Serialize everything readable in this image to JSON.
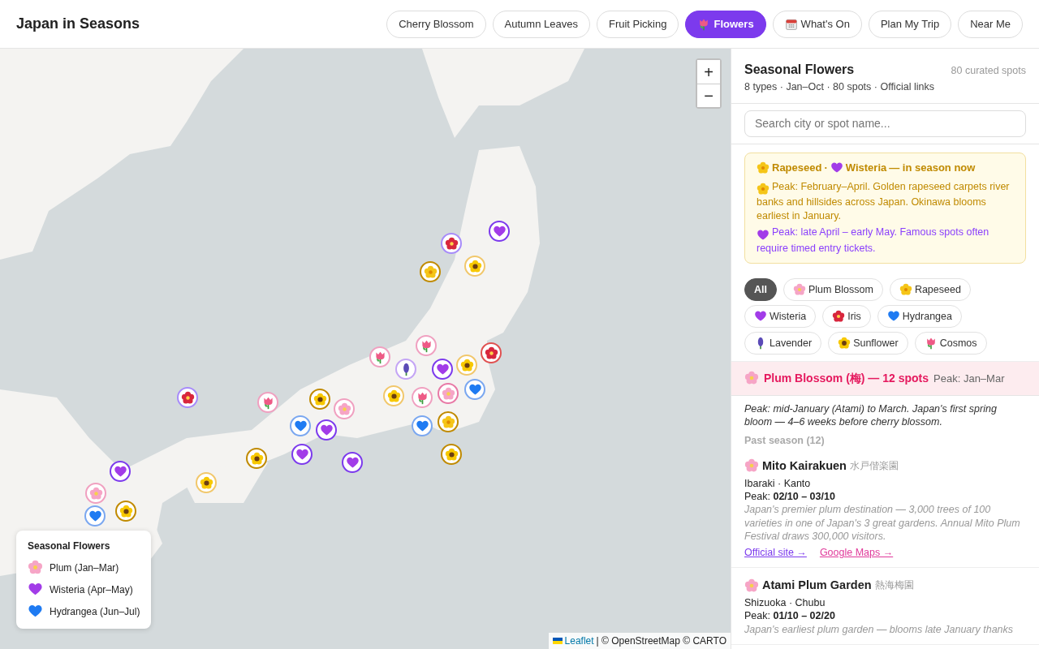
{
  "header": {
    "title": "Japan in Seasons",
    "nav": [
      {
        "label": "Cherry Blossom",
        "kind": "text",
        "selected": false
      },
      {
        "label": "Autumn Leaves",
        "kind": "text",
        "selected": false
      },
      {
        "label": "Fruit Picking",
        "kind": "text",
        "selected": false
      },
      {
        "label": "Flowers",
        "kind": "tulip",
        "selected": true
      },
      {
        "label": "What's On",
        "kind": "calendar",
        "selected": false
      },
      {
        "label": "Plan My Trip",
        "kind": "text",
        "selected": false
      },
      {
        "label": "Near Me",
        "kind": "text",
        "selected": false
      }
    ]
  },
  "map": {
    "zoom_in": "+",
    "zoom_out": "−",
    "legend": {
      "title": "Seasonal Flowers",
      "items": [
        {
          "kind": "plum",
          "label": "Plum (Jan–Mar)"
        },
        {
          "kind": "wisteria",
          "label": "Wisteria (Apr–May)"
        },
        {
          "kind": "hydrangea",
          "label": "Hydrangea (Jun–Jul)"
        }
      ]
    },
    "attribution": {
      "link": "Leaflet",
      "text": "| © OpenStreetMap © CARTO"
    }
  },
  "sidebar": {
    "title": "Seasonal Flowers",
    "count": "80 curated spots",
    "subtitle": "8 types · Jan–Oct · 80 spots · Official links",
    "search": {
      "placeholder": "Search city or spot name..."
    },
    "notice": {
      "title_parts": [
        {
          "kind": "rapeseed",
          "label": "Rapeseed"
        },
        {
          "kind": "wisteria",
          "label": "Wisteria"
        }
      ],
      "separator": "·",
      "title_suffix": "— in season now",
      "lines": [
        {
          "kind": "rapeseed",
          "text": "Peak: February–April. Golden rapeseed carpets river banks and hillsides across Japan. Okinawa blooms earliest in January."
        },
        {
          "kind": "wisteria",
          "text": "Peak: late April – early May. Famous spots often require timed entry tickets."
        }
      ]
    },
    "filters": [
      {
        "kind": "all",
        "label": "All",
        "selected": true
      },
      {
        "kind": "plum",
        "label": "Plum Blossom",
        "selected": false
      },
      {
        "kind": "rapeseed",
        "label": "Rapeseed",
        "selected": false
      },
      {
        "kind": "wisteria",
        "label": "Wisteria",
        "selected": false
      },
      {
        "kind": "iris",
        "label": "Iris",
        "selected": false
      },
      {
        "kind": "hydrangea",
        "label": "Hydrangea",
        "selected": false
      },
      {
        "kind": "lavender",
        "label": "Lavender",
        "selected": false
      },
      {
        "kind": "sunflower",
        "label": "Sunflower",
        "selected": false
      },
      {
        "kind": "cosmos",
        "label": "Cosmos",
        "selected": false
      }
    ],
    "section": {
      "kind": "plum",
      "title": "Plum Blossom (梅) — 12 spots",
      "peak": "Peak: Jan–Mar",
      "description": "Peak: mid-January (Atami) to March. Japan's first spring bloom — 4–6 weeks before cherry blossom.",
      "status": "Past season (12)"
    },
    "spots": [
      {
        "kind": "plum",
        "name": "Mito Kairakuen",
        "native": "水戸偕楽園",
        "location": "Ibaraki · Kanto",
        "peak": "Peak: **02/10 – 03/10**",
        "description": "Japan's premier plum destination — 3,000 trees of 100 varieties in one of Japan's 3 great gardens. Annual Mito Plum Festival draws 300,000 visitors.",
        "links": [
          {
            "kind": "official",
            "label": "Official site →"
          },
          {
            "kind": "maps",
            "label": "Google Maps →"
          }
        ]
      },
      {
        "kind": "plum",
        "name": "Atami Plum Garden",
        "native": "熱海梅園",
        "location": "Shizuoka · Chubu",
        "peak": "Peak: **01/10 – 02/20**",
        "description": "Japan's earliest plum garden — blooms late January thanks"
      }
    ]
  }
}
